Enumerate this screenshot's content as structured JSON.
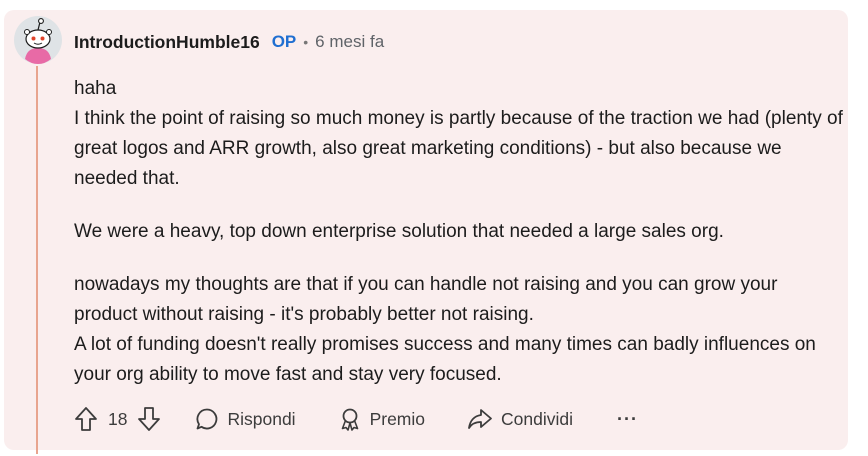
{
  "comment": {
    "author": "IntroductionHumble16",
    "op_badge": "OP",
    "separator": "•",
    "timestamp": "6 mesi fa",
    "paragraphs": [
      "haha",
      "I think the point of raising so much money is partly because of the traction we had (plenty of great logos and ARR growth, also great marketing conditions) - but also because we needed that.",
      "We were a heavy, top down enterprise solution that needed a large sales org.",
      "nowadays my thoughts are that if you can handle not raising and you can grow your product without raising - it's probably better not raising.",
      "A lot of funding doesn't really promises success and many times can badly influences on your org ability to move fast and stay very focused."
    ]
  },
  "actions": {
    "vote_count": "18",
    "reply_label": "Rispondi",
    "award_label": "Premio",
    "share_label": "Condividi",
    "more_label": "···"
  },
  "icons": {
    "upvote": "upvote-arrow-icon",
    "downvote": "downvote-arrow-icon",
    "reply": "speech-bubble-icon",
    "award": "award-ribbon-icon",
    "share": "share-arrow-icon",
    "more": "ellipsis-icon"
  },
  "colors": {
    "card_background": "#faeeee",
    "thread_line": "#e8a48e",
    "op_badge": "#1f6fd1",
    "text": "#1c1c1c"
  }
}
